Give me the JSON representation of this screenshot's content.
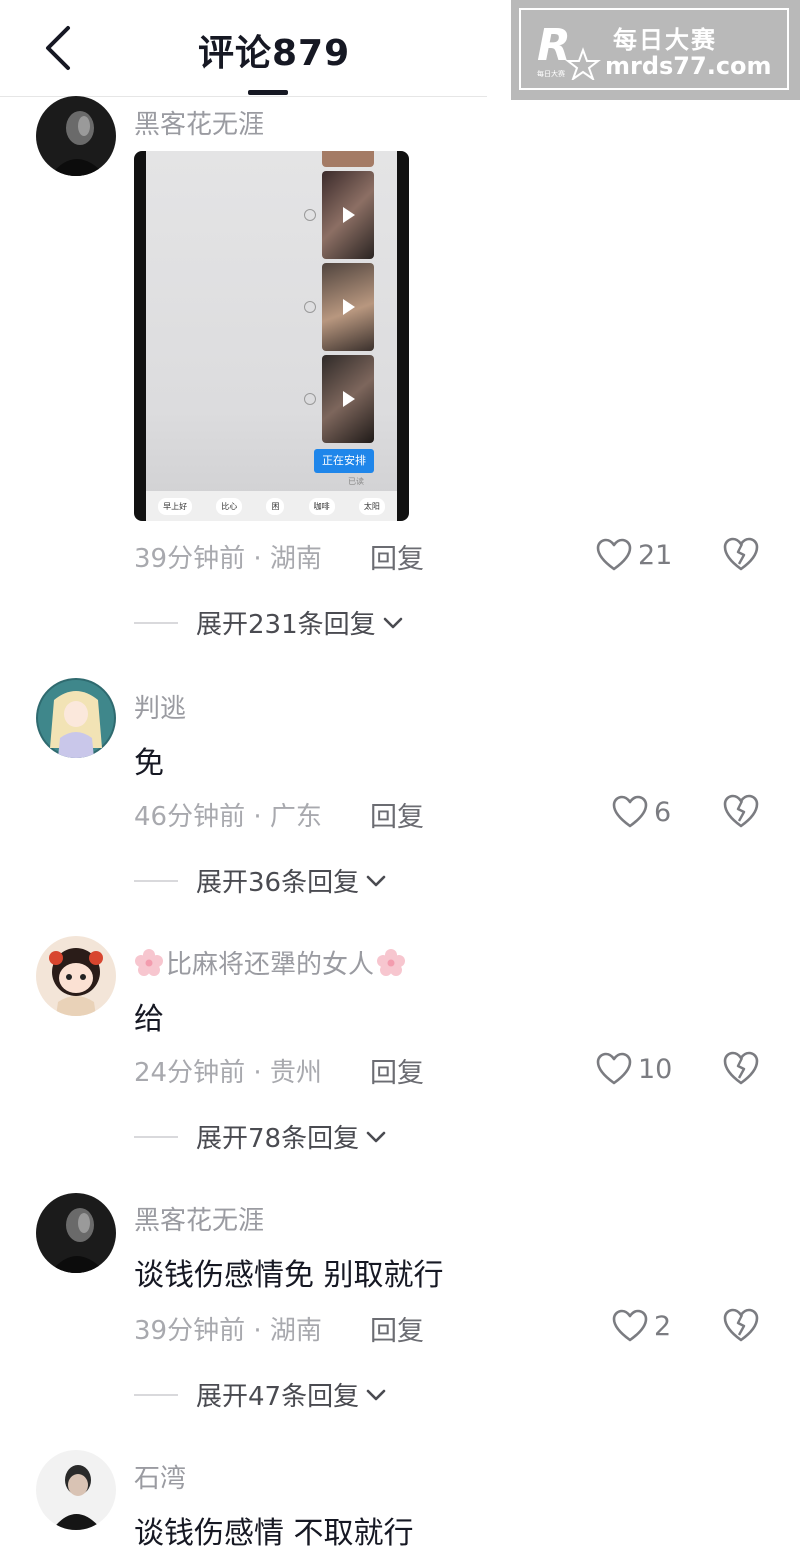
{
  "header": {
    "title": "评论879"
  },
  "watermark": {
    "brand_line1": "每日大赛",
    "brand_line2": "mrds77.com",
    "logo_text": "R",
    "logo_small": "每日大赛"
  },
  "image_preview": {
    "button": "正在安排",
    "read": "已读",
    "chips": [
      "早上好",
      "比心",
      "困",
      "咖啡",
      "太阳"
    ]
  },
  "comments": [
    {
      "username": "黑客花无涯",
      "text": "",
      "meta": "39分钟前 · 湖南",
      "reply": "回复",
      "likes": "21",
      "expand": "展开231条回复"
    },
    {
      "username": "判逃",
      "text": "免",
      "meta": "46分钟前 · 广东",
      "reply": "回复",
      "likes": "6",
      "expand": "展开36条回复"
    },
    {
      "username": "比麻将还犟的女人",
      "text": "给",
      "meta": "24分钟前 · 贵州",
      "reply": "回复",
      "likes": "10",
      "expand": "展开78条回复"
    },
    {
      "username": "黑客花无涯",
      "text": "谈钱伤感情免 别取就行",
      "meta": "39分钟前 · 湖南",
      "reply": "回复",
      "likes": "2",
      "expand": "展开47条回复"
    },
    {
      "username": "石湾",
      "text": "谈钱伤感情 不取就行",
      "meta": "",
      "reply": "",
      "likes": "",
      "expand": ""
    }
  ],
  "colors": {
    "text": "#161823",
    "secondary": "#9a9ba1",
    "accent_blue": "#1f86ea"
  }
}
